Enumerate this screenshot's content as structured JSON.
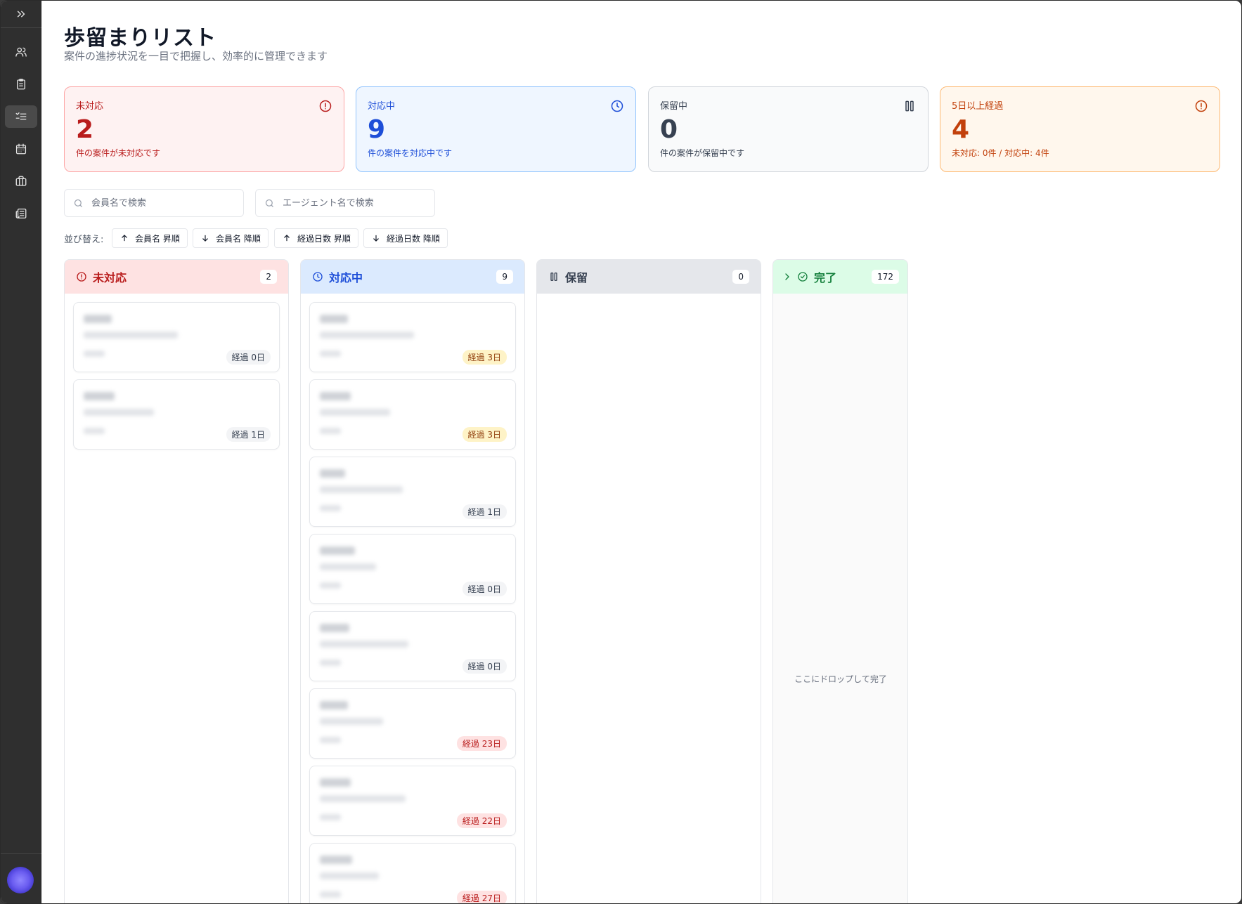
{
  "page": {
    "title": "歩留まりリスト",
    "subtitle": "案件の進捗状況を一目で把握し、効率的に管理できます"
  },
  "sidebar": {
    "items": [
      {
        "name": "expand-icon"
      },
      {
        "name": "users-icon"
      },
      {
        "name": "clipboard-icon"
      },
      {
        "name": "checklist-icon"
      },
      {
        "name": "calendar-icon"
      },
      {
        "name": "briefcase-icon"
      },
      {
        "name": "newspaper-icon"
      }
    ],
    "active_index": 3
  },
  "stats": [
    {
      "label": "未対応",
      "value": "2",
      "desc": "件の案件が未対応です",
      "icon": "alert-circle-icon",
      "color": "#b91c1c",
      "bg": "#fef2f2",
      "border": "#fca5a5"
    },
    {
      "label": "対応中",
      "value": "9",
      "desc": "件の案件を対応中です",
      "icon": "clock-icon",
      "color": "#1d4ed8",
      "bg": "#eff6ff",
      "border": "#93c5fd"
    },
    {
      "label": "保留中",
      "value": "0",
      "desc": "件の案件が保留中です",
      "icon": "pause-icon",
      "color": "#374151",
      "bg": "#f9fafb",
      "border": "#d1d5db"
    },
    {
      "label": "5日以上経過",
      "value": "4",
      "desc": "未対応: 0件 / 対応中: 4件",
      "icon": "alert-circle-icon",
      "color": "#c2410c",
      "bg": "#fff7ed",
      "border": "#fdba74"
    }
  ],
  "search": {
    "member_placeholder": "会員名で検索",
    "agent_placeholder": "エージェント名で検索"
  },
  "sort": {
    "label": "並び替え:",
    "buttons": [
      "会員名 昇順",
      "会員名 降順",
      "経過日数 昇順",
      "経過日数 降順"
    ]
  },
  "columns": [
    {
      "title": "未対応",
      "count": "2",
      "icon": "alert-circle-icon",
      "color": "#b91c1c",
      "head_bg": "#fee2e2",
      "cards": [
        {
          "badge": "経過 0日",
          "level": "gray"
        },
        {
          "badge": "経過 1日",
          "level": "gray"
        }
      ]
    },
    {
      "title": "対応中",
      "count": "9",
      "icon": "clock-icon",
      "color": "#1d4ed8",
      "head_bg": "#dbeafe",
      "cards": [
        {
          "badge": "経過 3日",
          "level": "yellow"
        },
        {
          "badge": "経過 3日",
          "level": "yellow"
        },
        {
          "badge": "経過 1日",
          "level": "gray"
        },
        {
          "badge": "経過 0日",
          "level": "gray"
        },
        {
          "badge": "経過 0日",
          "level": "gray"
        },
        {
          "badge": "経過 23日",
          "level": "red"
        },
        {
          "badge": "経過 22日",
          "level": "red"
        },
        {
          "badge": "経過 27日",
          "level": "red"
        }
      ]
    },
    {
      "title": "保留",
      "count": "0",
      "icon": "pause-icon",
      "color": "#374151",
      "head_bg": "#e5e7eb",
      "cards": []
    },
    {
      "title": "完了",
      "count": "172",
      "icon": "check-circle-icon",
      "color": "#15803d",
      "head_bg": "#dcfce7",
      "cards": [],
      "drop_text": "ここにドロップして完了"
    }
  ]
}
